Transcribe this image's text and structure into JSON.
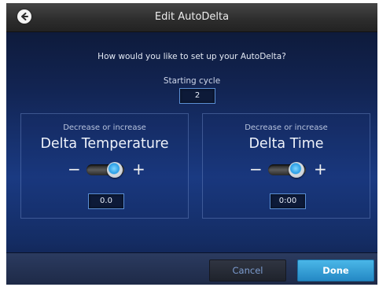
{
  "header": {
    "title": "Edit AutoDelta",
    "back_icon": "back-arrow-icon"
  },
  "question": "How would you like to set up your AutoDelta?",
  "starting_cycle": {
    "label": "Starting cycle",
    "value": "2"
  },
  "temperature_panel": {
    "subtitle": "Decrease or increase",
    "title": "Delta Temperature",
    "minus": "−",
    "plus": "+",
    "toggle_position": "increase",
    "value": "0.0"
  },
  "time_panel": {
    "subtitle": "Decrease or increase",
    "title": "Delta Time",
    "minus": "−",
    "plus": "+",
    "toggle_position": "increase",
    "value": "0:00"
  },
  "footer": {
    "cancel_label": "Cancel",
    "done_label": "Done"
  },
  "colors": {
    "accent": "#2f9fe0",
    "background": "#1a3a82",
    "titlebar": "#2e2e2e"
  }
}
